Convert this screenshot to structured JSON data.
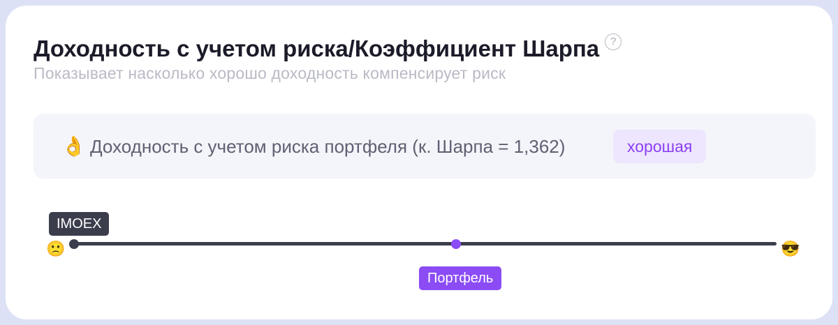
{
  "card": {
    "title": "Доходность с учетом риска/Коэффициент Шарпа",
    "help_icon": "?",
    "subtitle": "Показывает насколько хорошо доходность компенсирует риск"
  },
  "summary": {
    "emoji": "👌",
    "text": "Доходность с учетом риска портфеля (к. Шарпа = 1,362)",
    "rating": "хорошая"
  },
  "scale": {
    "left_emoji": "🙁",
    "right_emoji": "😎",
    "benchmark_label": "IMOEX",
    "portfolio_label": "Портфель",
    "benchmark_position_fraction": 0.0,
    "portfolio_position_fraction": 0.54
  },
  "colors": {
    "accent": "#8b4cf5",
    "badge_bg": "#eee5ff",
    "scale_line": "#3b3d4d",
    "panel_bg": "#f4f5fa",
    "page_bg": "#dde1f5"
  }
}
